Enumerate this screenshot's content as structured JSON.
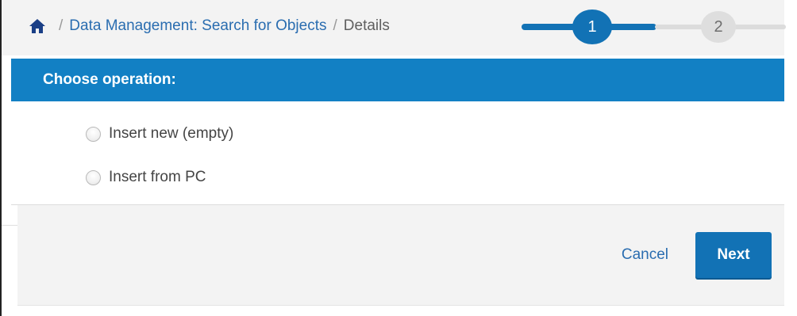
{
  "breadcrumb": {
    "home_icon": "home-icon",
    "separator": "/",
    "items": [
      {
        "label": "Data Management: Search for Objects"
      },
      {
        "label": "Details"
      }
    ]
  },
  "wizard": {
    "steps": [
      {
        "number": "1",
        "state": "active"
      },
      {
        "number": "2",
        "state": "inactive"
      }
    ]
  },
  "panel": {
    "header": "Choose operation:",
    "options": [
      {
        "label": "Insert new (empty)",
        "selected": false
      },
      {
        "label": "Insert from PC",
        "selected": false
      }
    ]
  },
  "footer": {
    "cancel_label": "Cancel",
    "next_label": "Next"
  },
  "colors": {
    "accent": "#1280c4",
    "primary_button": "#1272b5",
    "link": "#2a6db0"
  }
}
